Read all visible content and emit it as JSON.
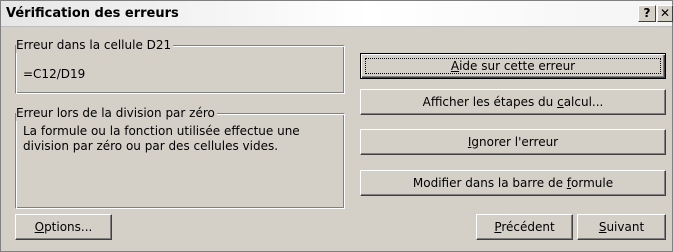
{
  "window": {
    "title": "Vérification des erreurs",
    "help_button": "?",
    "close_button": "✕"
  },
  "cell_group": {
    "label": "Erreur dans la cellule D21",
    "formula": "=C12/D19"
  },
  "error_group": {
    "label": "Erreur lors de la division par zéro",
    "description": "La formule ou la fonction utilisée effectue une division par zéro ou par des cellules vides."
  },
  "buttons": {
    "help_pre": "",
    "help_mnemonic": "A",
    "help_post": "ide sur cette erreur",
    "steps_pre": "Afficher les étapes du ",
    "steps_mnemonic": "c",
    "steps_post": "alcul...",
    "ignore_pre": "",
    "ignore_mnemonic": "I",
    "ignore_post": "gnorer l'erreur",
    "edit_pre": "Modifier dans la barre de ",
    "edit_mnemonic": "f",
    "edit_post": "ormule",
    "options_pre": "",
    "options_mnemonic": "O",
    "options_post": "ptions...",
    "previous_pre": "",
    "previous_mnemonic": "P",
    "previous_post": "récédent",
    "next_pre": "",
    "next_mnemonic": "S",
    "next_post": "uivant"
  }
}
